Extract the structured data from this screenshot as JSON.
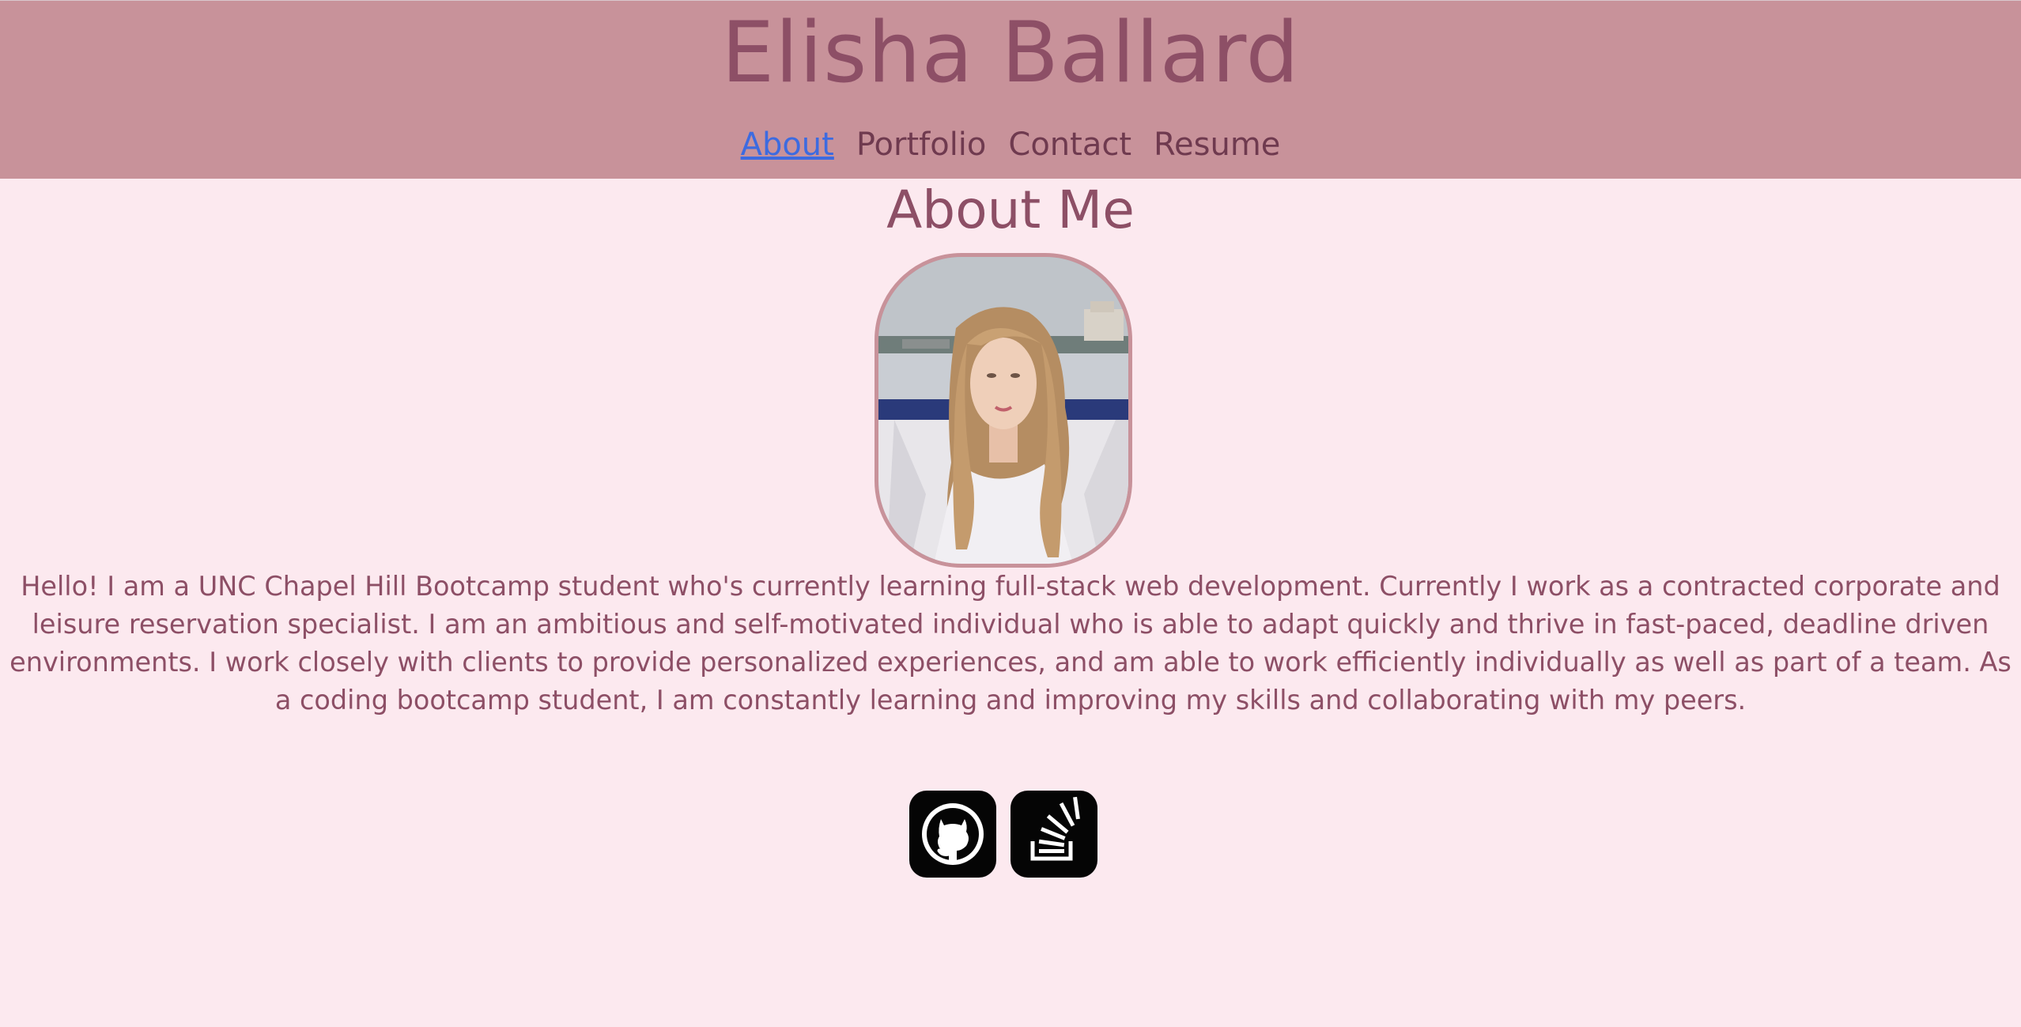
{
  "header": {
    "title": "Elisha Ballard",
    "nav": [
      {
        "label": "About",
        "active": true
      },
      {
        "label": "Portfolio",
        "active": false
      },
      {
        "label": "Contact",
        "active": false
      },
      {
        "label": "Resume",
        "active": false
      }
    ]
  },
  "about": {
    "heading": "About Me",
    "photo_icon": "portrait-photo",
    "bio": "Hello! I am a UNC Chapel Hill Bootcamp student who's currently learning full-stack web development. Currently I work as a contracted corporate and leisure reservation specialist. I am an ambitious and self-motivated individual who is able to adapt quickly and thrive in fast-paced, deadline driven environments. I work closely with clients to provide personalized experiences, and am able to work efficiently individually as well as part of a team. As a coding bootcamp student, I am constantly learning and improving my skills and collaborating with my peers."
  },
  "social": [
    {
      "icon": "github-icon"
    },
    {
      "icon": "stackoverflow-icon"
    }
  ],
  "colors": {
    "background": "#fce9ef",
    "header": "#c8929a",
    "title_text": "#8d4f66",
    "nav_text": "#6f3a4f",
    "active_link": "#3d6be0"
  }
}
